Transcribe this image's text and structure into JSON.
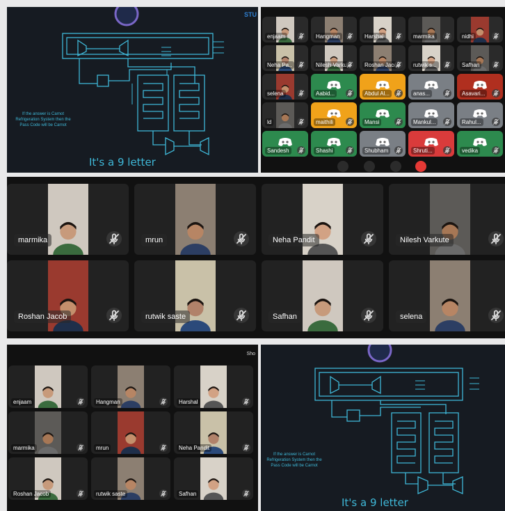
{
  "slide": {
    "caption": "It's a 9 letter",
    "note_lines": [
      "If the answer is Carnot",
      "Refrigeration System then the",
      "Pass Code will be Carnot"
    ],
    "brand_text": "STU"
  },
  "grid_small": {
    "tiles": [
      "enjaam",
      "Hangman",
      "Harshal",
      "marmika",
      "nidhi",
      "Neha Pa..",
      "Nilesh Varkute",
      "Roshan Jacob",
      "rutwik s...",
      "Safhan",
      "selena",
      "Aabid...",
      "Abdul Al...",
      "anas...",
      "Asavari...",
      "ld",
      "maithili",
      "Mansi",
      "Mankul...",
      "Rahul...",
      "Sandesh",
      "Shashi",
      "Shubham",
      "Shruti...",
      "vedika"
    ],
    "tile_colors": [
      "#2a2a2a",
      "#2a2a2a",
      "#2a2a2a",
      "#2a2a2a",
      "#2a2a2a",
      "#2a2a2a",
      "#2a2a2a",
      "#2a2a2a",
      "#2a2a2a",
      "#2a2a2a",
      "#2a2a2a",
      "#2d8a4e",
      "#f0a21a",
      "#7a7f85",
      "#b02f1f",
      "#2a2a2a",
      "#f0a21a",
      "#2d8a4e",
      "#7a7f85",
      "#7a7f85",
      "#2d8a4e",
      "#2d8a4e",
      "#7a7f85",
      "#d93b3b",
      "#2d8a4e"
    ]
  },
  "grid_big": {
    "tiles": [
      "marmika",
      "mrun",
      "Neha Pandit",
      "Nilesh Varkute",
      "Roshan Jacob",
      "rutwik saste",
      "Safhan",
      "selena"
    ]
  },
  "grid_bottom": {
    "tiles": [
      "enjaam",
      "Hangman",
      "Harshal",
      "marmika",
      "mrun",
      "Neha Pandit",
      "Roshan Jacob",
      "rutwik saste",
      "Safhan"
    ],
    "label_share": "Sho"
  },
  "colors": {
    "slide_bg": "#161b22",
    "slide_line": "#3fb8d8",
    "tile_bg": "#222222",
    "end_call": "#e53935"
  }
}
